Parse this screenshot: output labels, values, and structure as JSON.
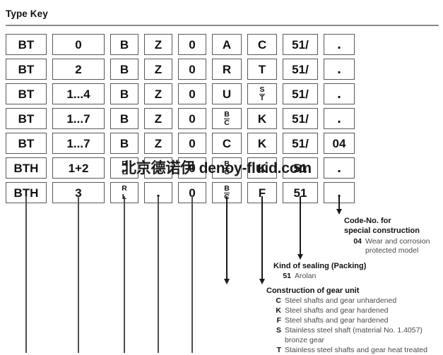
{
  "header": {
    "title": "Type Key"
  },
  "watermark": {
    "text": "北京德诺伊 denoy-fluid.com"
  },
  "typekey": {
    "rows": [
      {
        "cells": [
          {
            "text": "BT"
          },
          {
            "text": "0"
          },
          {
            "text": "B"
          },
          {
            "text": "Z"
          },
          {
            "text": "0"
          },
          {
            "text": "A"
          },
          {
            "text": "C"
          },
          {
            "text": "51/"
          },
          {
            "text": "."
          }
        ]
      },
      {
        "cells": [
          {
            "text": "BT"
          },
          {
            "text": "2"
          },
          {
            "text": "B"
          },
          {
            "text": "Z"
          },
          {
            "text": "0"
          },
          {
            "text": "R"
          },
          {
            "text": "T"
          },
          {
            "text": "51/"
          },
          {
            "text": "."
          }
        ]
      },
      {
        "cells": [
          {
            "text": "BT"
          },
          {
            "text": "1...4"
          },
          {
            "text": "B"
          },
          {
            "text": "Z"
          },
          {
            "text": "0"
          },
          {
            "text": "U"
          },
          {
            "top": "S",
            "bottom": "T",
            "ruled": true
          },
          {
            "text": "51/"
          },
          {
            "text": "."
          }
        ]
      },
      {
        "cells": [
          {
            "text": "BT"
          },
          {
            "text": "1...7"
          },
          {
            "text": "B"
          },
          {
            "text": "Z"
          },
          {
            "text": "0"
          },
          {
            "top": "B",
            "bottom": "C",
            "ruled": true
          },
          {
            "text": "K"
          },
          {
            "text": "51/"
          },
          {
            "text": "."
          }
        ]
      },
      {
        "cells": [
          {
            "text": "BT"
          },
          {
            "text": "1...7"
          },
          {
            "text": "B"
          },
          {
            "text": "Z"
          },
          {
            "text": "0"
          },
          {
            "text": "C"
          },
          {
            "text": "K"
          },
          {
            "text": "51/"
          },
          {
            "text": "04"
          }
        ]
      },
      {
        "cells": [
          {
            "text": "BTH"
          },
          {
            "text": "1+2"
          },
          {
            "top": "R",
            "bottom": "L",
            "ruled": false
          },
          {
            "text": "."
          },
          {
            "text": "0"
          },
          {
            "top": "B",
            "bottom": "C",
            "ruled": true
          },
          {
            "text": "K"
          },
          {
            "text": "51"
          },
          {
            "text": "."
          }
        ]
      },
      {
        "cells": [
          {
            "text": "BTH"
          },
          {
            "text": "3"
          },
          {
            "top": "R",
            "bottom": "L",
            "ruled": false
          },
          {
            "text": "."
          },
          {
            "text": "0"
          },
          {
            "top": "B",
            "bottom": "C",
            "ruled": true
          },
          {
            "text": "F"
          },
          {
            "text": "51"
          },
          {
            "text": "."
          }
        ]
      }
    ]
  },
  "annotations": {
    "code_no": {
      "title_line1": "Code-No. for",
      "title_line2": "special construction",
      "entries": [
        {
          "code": "04",
          "text": "Wear and corrosion",
          "cont": "protected model"
        }
      ]
    },
    "sealing": {
      "title": "Kind of sealing (Packing)",
      "entries": [
        {
          "code": "51",
          "text": "Arolan"
        }
      ]
    },
    "gear_unit": {
      "title": "Construction of gear unit",
      "entries": [
        {
          "code": "C",
          "text": "Steel shafts and gear unhardened"
        },
        {
          "code": "K",
          "text": "Steel shafts and gear hardened"
        },
        {
          "code": "F",
          "text": "Steel shafts and gear hardened"
        },
        {
          "code": "S",
          "text": "Stainless steel shaft (material No. 1.4057)",
          "cont": "bronze gear"
        },
        {
          "code": "T",
          "text": "Stainless steel shafts and gear heat treated"
        }
      ]
    }
  }
}
